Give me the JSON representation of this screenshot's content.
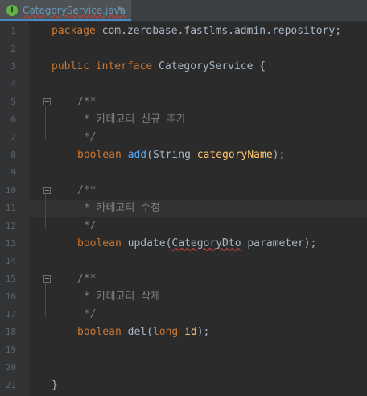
{
  "tab": {
    "label": "CategoryService.java",
    "icon": "interface-icon",
    "close": "×"
  },
  "lines": [
    {
      "n": "1"
    },
    {
      "n": "2"
    },
    {
      "n": "3"
    },
    {
      "n": "4"
    },
    {
      "n": "5"
    },
    {
      "n": "6"
    },
    {
      "n": "7"
    },
    {
      "n": "8"
    },
    {
      "n": "9"
    },
    {
      "n": "10"
    },
    {
      "n": "11"
    },
    {
      "n": "12"
    },
    {
      "n": "13"
    },
    {
      "n": "14"
    },
    {
      "n": "15"
    },
    {
      "n": "16"
    },
    {
      "n": "17"
    },
    {
      "n": "18"
    },
    {
      "n": "19"
    },
    {
      "n": "20"
    },
    {
      "n": "21"
    }
  ],
  "code": {
    "l1_kw": "package",
    "l1_rest": " com.zerobase.fastlms.admin.repository;",
    "l3_kw": "public interface",
    "l3_rest": " CategoryService {",
    "l5": "/**",
    "l6": " * 카테고리 신규 추가",
    "l7": " */",
    "l8_kw": "boolean",
    "l8_fn": "add",
    "l8_p1": "(",
    "l8_type": "String",
    "l8_arg": " categoryName",
    "l8_end": ");",
    "l10": "/**",
    "l11": " * 카테고리 수정",
    "l12": " */",
    "l13_kw": "boolean",
    "l13_fn": "update",
    "l13_p1": "(",
    "l13_type": "CategoryDto",
    "l13_arg": " parameter",
    "l13_end": ");",
    "l15": "/**",
    "l16": " * 카테고리 삭제",
    "l17": " */",
    "l18_kw": "boolean",
    "l18_fn": "del",
    "l18_p1": "(",
    "l18_type": "long",
    "l18_arg": " id",
    "l18_end": ");",
    "l21": "}"
  },
  "colors": {
    "keyword": "#cc7832",
    "comment": "#808080",
    "method": "#ffc66d",
    "method_default": "#56a8f5",
    "text": "#a9b7c6",
    "background": "#2b2b2b"
  }
}
